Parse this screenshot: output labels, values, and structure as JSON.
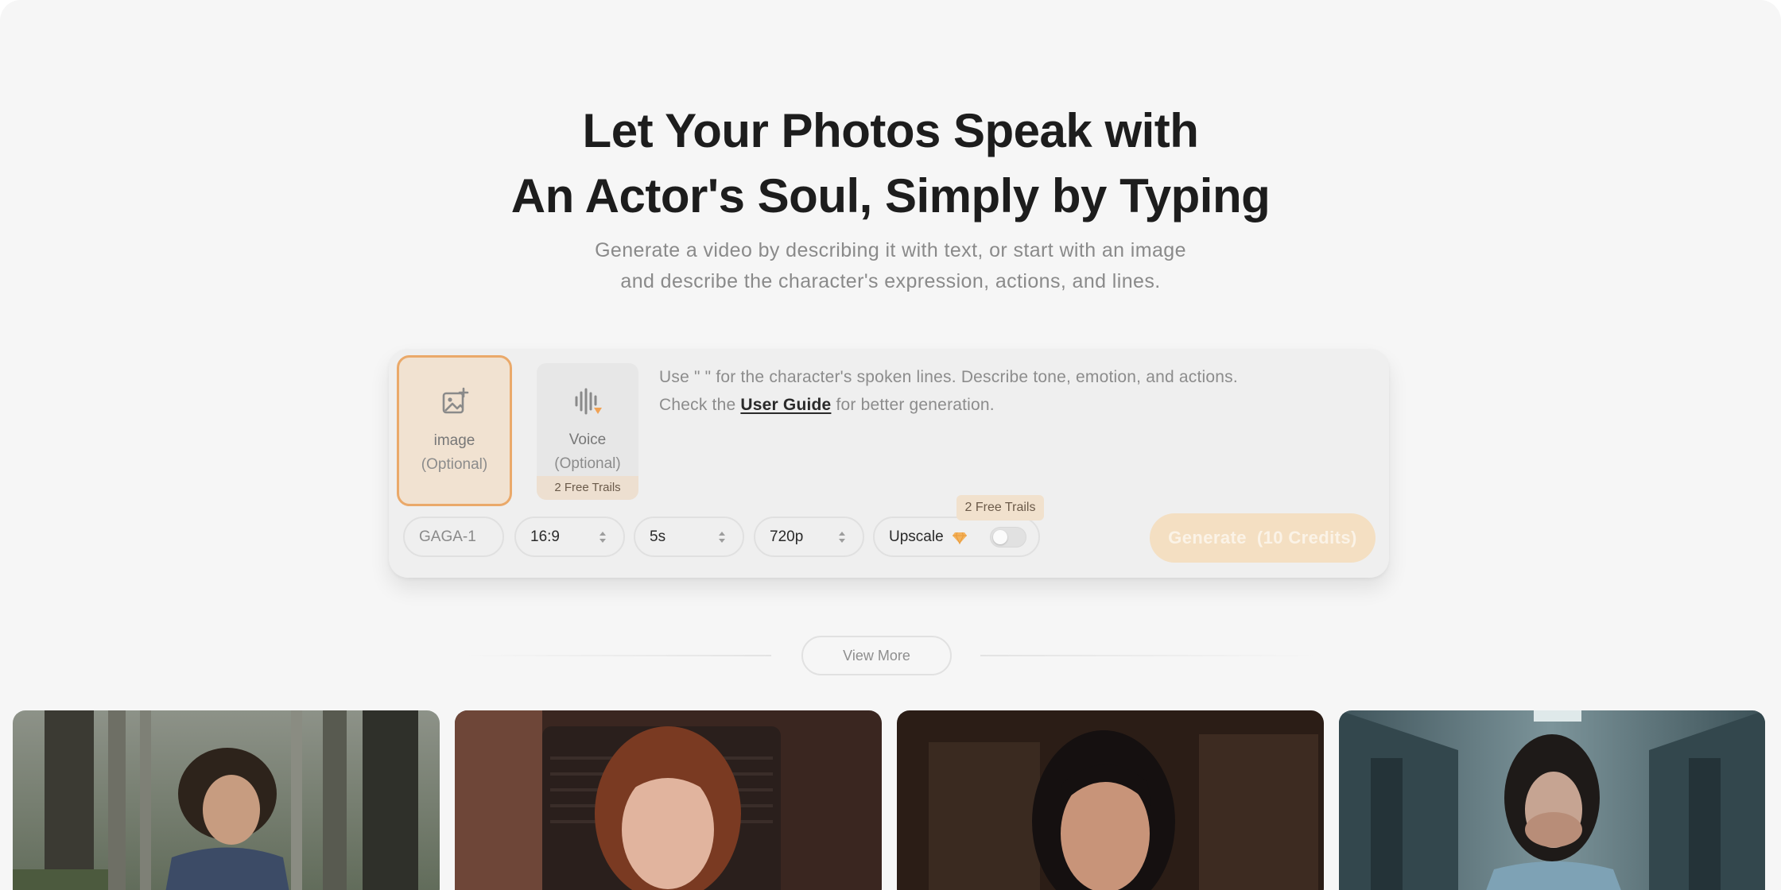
{
  "hero": {
    "title_line1": "Let Your Photos Speak with",
    "title_line2": "An Actor's Soul, Simply by Typing",
    "subtitle_line1": "Generate a video by describing it with text, or start with an image",
    "subtitle_line2": "and describe the character's expression, actions, and lines."
  },
  "composer": {
    "image_card": {
      "label": "image",
      "sublabel": "(Optional)",
      "icon": "image-plus-icon"
    },
    "voice_card": {
      "label": "Voice",
      "sublabel": "(Optional)",
      "badge": "2 Free Trails",
      "icon": "voice-wave-icon"
    },
    "prompt": {
      "line1": "Use \" \" for the character's spoken lines. Describe tone, emotion, and actions.",
      "line2_prefix": "Check the ",
      "guide_link": "User Guide",
      "line2_suffix": " for better generation."
    },
    "controls": {
      "model": "GAGA-1",
      "ratio": "16:9",
      "duration": "5s",
      "resolution": "720p",
      "upscale_label": "Upscale",
      "upscale_enabled": false,
      "upscale_tip": "2 Free Trails"
    },
    "generate_label": "Generate  (10 Credits)"
  },
  "view_more_label": "View More",
  "colors": {
    "accent": "#eaa96a",
    "accent_soft": "#f1e2d1",
    "page_bg": "#f6f6f6",
    "generate_bg": "#f4dfc2"
  }
}
